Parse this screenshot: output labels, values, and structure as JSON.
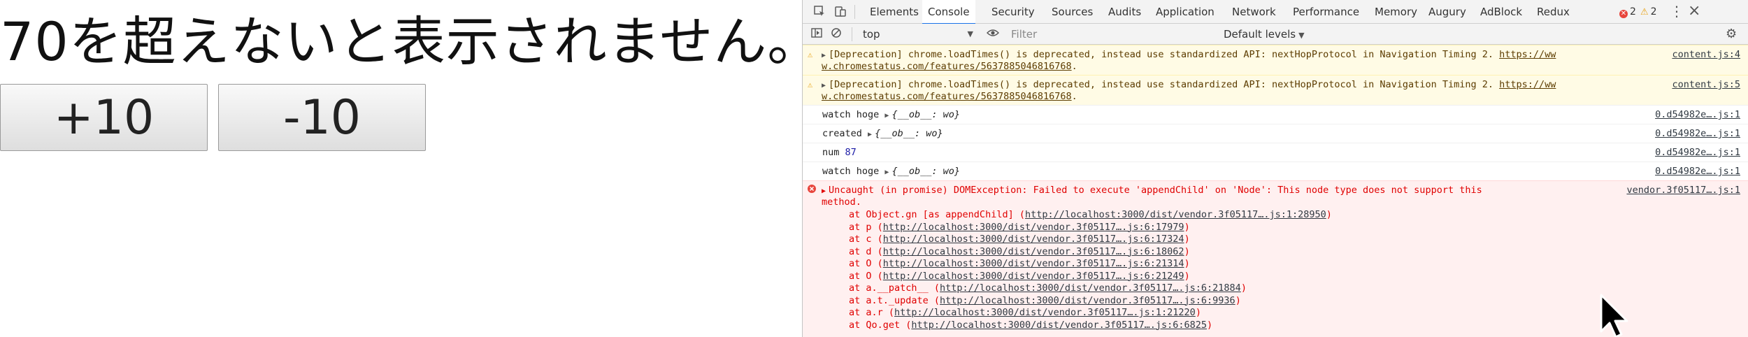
{
  "page": {
    "message": "70を超えないと表示されません。",
    "buttons": {
      "plus": "+10",
      "minus": "-10"
    }
  },
  "devtools": {
    "icons": [
      "inspect-icon",
      "device-icon",
      "clear-icon",
      "eye-icon",
      "gear-icon",
      "kebab-icon"
    ],
    "tabs": [
      "Elements",
      "Console",
      "Security",
      "Sources",
      "Audits",
      "Application",
      "Network",
      "Performance",
      "Memory",
      "Augury",
      "AdBlock",
      "Redux"
    ],
    "active_tab": "Console",
    "error_count": "2",
    "warning_count": "2",
    "context": "top",
    "filter_placeholder": "Filter",
    "levels": "Default levels",
    "colors": {
      "warn_bg": "#fffbe5",
      "error_bg": "#fff0f0",
      "error_text": "#e00000",
      "accent": "#1a73e8"
    }
  },
  "console": {
    "warn1": {
      "text1": "[Deprecation] chrome.loadTimes() is deprecated, instead use standardized API: nextHopProtocol in Navigation Timing 2. ",
      "link1": "https://ww",
      "link2": "w.chromestatus.com/features/5637885046816768",
      "tail": ".",
      "src": "content.js:4"
    },
    "warn2": {
      "text1": "[Deprecation] chrome.loadTimes() is deprecated, instead use standardized API: nextHopProtocol in Navigation Timing 2. ",
      "link1": "https://ww",
      "link2": "w.chromestatus.com/features/5637885046816768",
      "tail": ".",
      "src": "content.js:5"
    },
    "logs": [
      {
        "text": "watch hoge ",
        "obj": "{__ob__: wo}",
        "src": "0.d54982e….js:1"
      },
      {
        "text": "created ",
        "obj": "{__ob__: wo}",
        "src": "0.d54982e….js:1"
      },
      {
        "text": "num ",
        "num": "87",
        "src": "0.d54982e….js:1"
      },
      {
        "text": "watch hoge ",
        "obj": "{__ob__: wo}",
        "src": "0.d54982e….js:1"
      }
    ],
    "error": {
      "line1": "Uncaught (in promise) DOMException: Failed to execute 'appendChild' on 'Node': This node type does not support this",
      "line2": "method.",
      "src": "vendor.3f05117….js:1",
      "stack": [
        {
          "at": "at Object.gn [as appendChild] (",
          "link": "http://localhost:3000/dist/vendor.3f05117….js:1:28950",
          "end": ")"
        },
        {
          "at": "at p (",
          "link": "http://localhost:3000/dist/vendor.3f05117….js:6:17979",
          "end": ")"
        },
        {
          "at": "at c (",
          "link": "http://localhost:3000/dist/vendor.3f05117….js:6:17324",
          "end": ")"
        },
        {
          "at": "at d (",
          "link": "http://localhost:3000/dist/vendor.3f05117….js:6:18062",
          "end": ")"
        },
        {
          "at": "at O (",
          "link": "http://localhost:3000/dist/vendor.3f05117….js:6:21314",
          "end": ")"
        },
        {
          "at": "at O (",
          "link": "http://localhost:3000/dist/vendor.3f05117….js:6:21249",
          "end": ")"
        },
        {
          "at": "at a.__patch__ (",
          "link": "http://localhost:3000/dist/vendor.3f05117….js:6:21884",
          "end": ")"
        },
        {
          "at": "at a.t._update (",
          "link": "http://localhost:3000/dist/vendor.3f05117….js:6:9936",
          "end": ")"
        },
        {
          "at": "at a.r (",
          "link": "http://localhost:3000/dist/vendor.3f05117….js:1:21220",
          "end": ")"
        },
        {
          "at": "at Qo.get (",
          "link": "http://localhost:3000/dist/vendor.3f05117….js:6:6825",
          "end": ")"
        }
      ]
    }
  }
}
